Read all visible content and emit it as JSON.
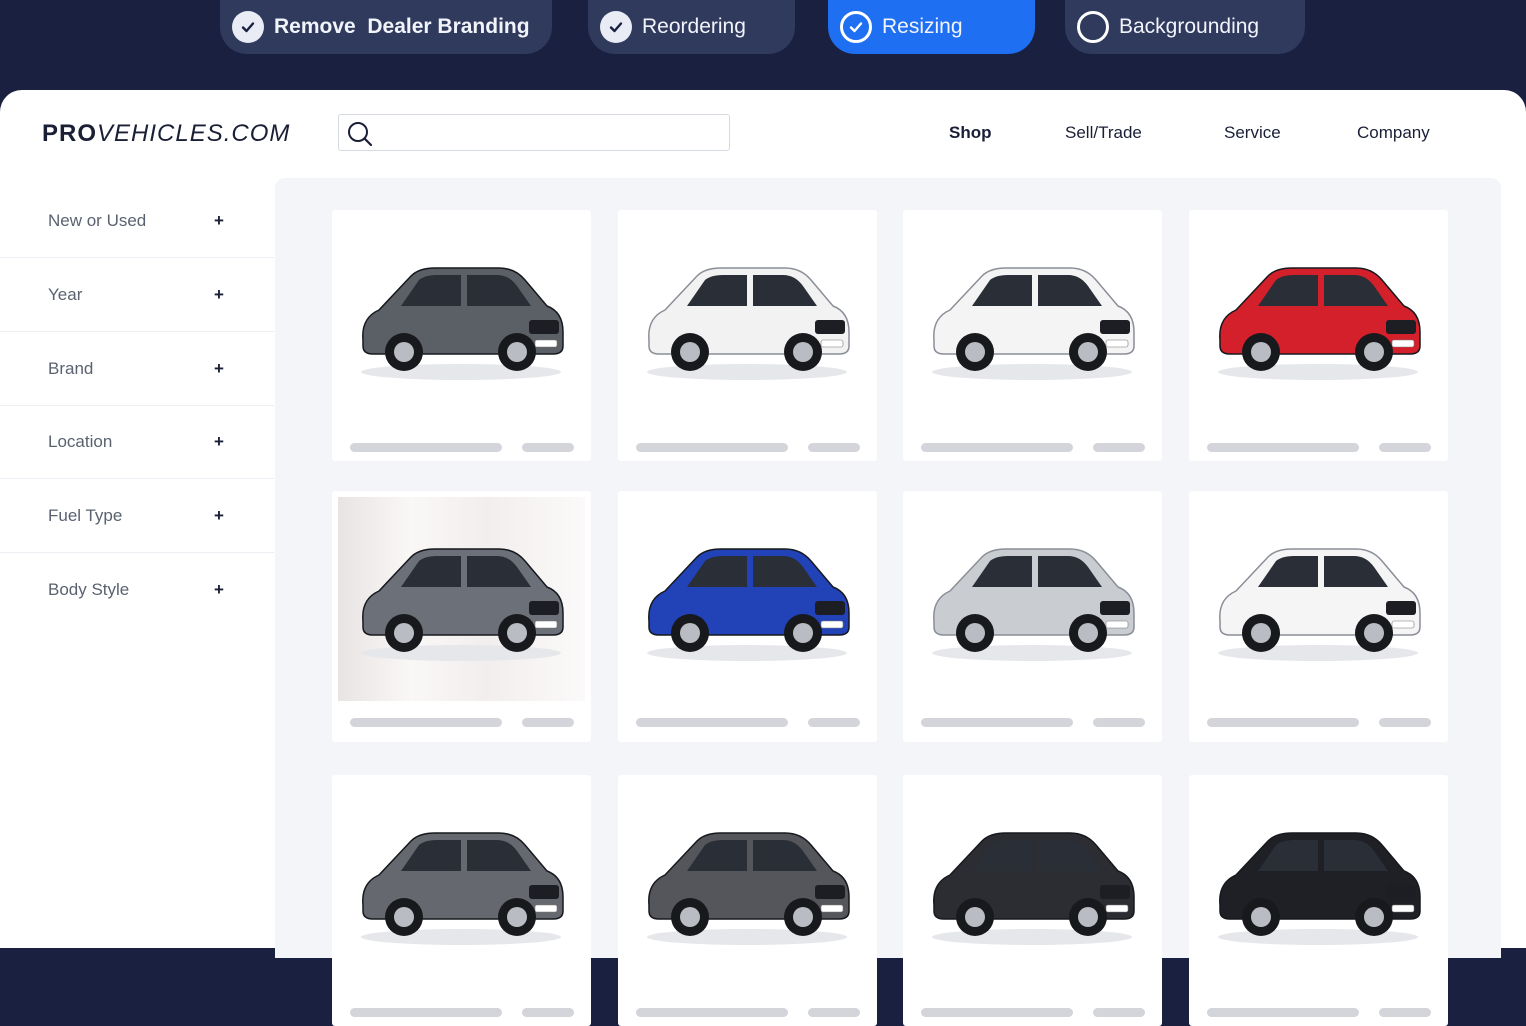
{
  "steps": [
    {
      "label": "Remove  Dealer Branding",
      "state": "done"
    },
    {
      "label": "Reordering",
      "state": "done"
    },
    {
      "label": "Resizing",
      "state": "active"
    },
    {
      "label": "Backgrounding",
      "state": "pending"
    }
  ],
  "header": {
    "logo_bold": "PRO",
    "logo_rest": "VEHICLES.COM",
    "search_placeholder": "",
    "nav": [
      "Shop",
      "Sell/Trade",
      "Service",
      "Company"
    ]
  },
  "filters": [
    {
      "label": "New or Used",
      "toggle": "+"
    },
    {
      "label": "Year",
      "toggle": "+"
    },
    {
      "label": "Brand",
      "toggle": "+"
    },
    {
      "label": "Location",
      "toggle": "+"
    },
    {
      "label": "Fuel Type",
      "toggle": "+"
    },
    {
      "label": "Body Style",
      "toggle": "+"
    }
  ],
  "listings": [
    {
      "icon": "grey-suv-icon",
      "color": "#5b5f66"
    },
    {
      "icon": "white-offroader-icon",
      "color": "#f2f2f2"
    },
    {
      "icon": "white-compact-suv-icon",
      "color": "#f4f4f4"
    },
    {
      "icon": "red-compact-suv-icon",
      "color": "#d3202a"
    },
    {
      "icon": "grey-estate-car-icon",
      "color": "#6c7079"
    },
    {
      "icon": "blue-compact-suv-icon",
      "color": "#2243b8"
    },
    {
      "icon": "silver-suv-icon",
      "color": "#c9ccd1"
    },
    {
      "icon": "white-hatchback-icon",
      "color": "#f5f5f5"
    },
    {
      "icon": "grey-saloon-icon",
      "color": "#66686f"
    },
    {
      "icon": "grey-crossover-icon",
      "color": "#55565c"
    },
    {
      "icon": "black-suv-icon",
      "color": "#2b2d33"
    },
    {
      "icon": "black-small-suv-icon",
      "color": "#1e2026"
    }
  ]
}
